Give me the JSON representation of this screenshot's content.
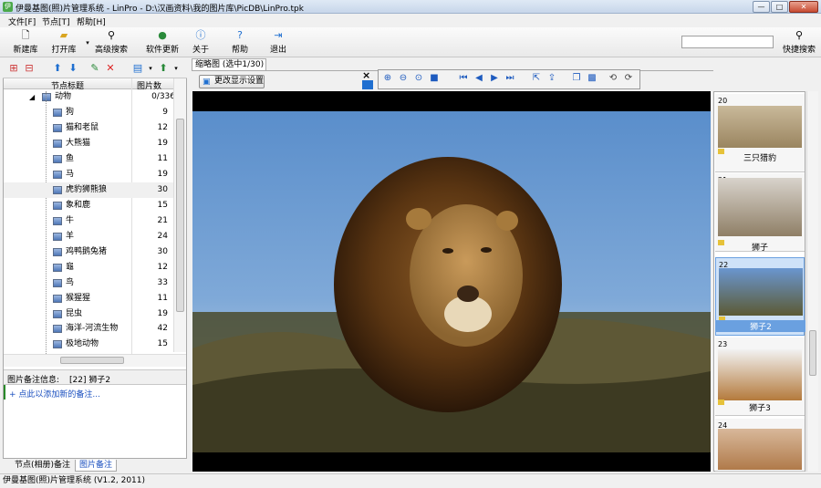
{
  "window": {
    "title": "伊曼基图(照)片管理系统 - LinPro - D:\\汉画资料\\我的图片库\\PicDB\\LinPro.tpk",
    "minimize": "—",
    "maximize": "□",
    "close": "✕"
  },
  "menubar": [
    "文件[F]",
    "节点[T]",
    "帮助[H]"
  ],
  "toolbar": {
    "new_db": "新建库",
    "open_db": "打开库",
    "advanced_search": "高级搜索",
    "update": "软件更新",
    "about": "关于",
    "help": "帮助",
    "exit": "退出",
    "quick_search": "快捷搜索",
    "search_value": ""
  },
  "tree": {
    "col_title": "节点标题",
    "col_count": "图片数",
    "root": {
      "label": "动物",
      "count": "0/336"
    },
    "items": [
      {
        "label": "狗",
        "count": "9"
      },
      {
        "label": "猫和老鼠",
        "count": "12"
      },
      {
        "label": "大熊猫",
        "count": "19"
      },
      {
        "label": "鱼",
        "count": "11"
      },
      {
        "label": "马",
        "count": "19"
      },
      {
        "label": "虎豹狮熊狼",
        "count": "30"
      },
      {
        "label": "象和鹿",
        "count": "15"
      },
      {
        "label": "牛",
        "count": "21"
      },
      {
        "label": "羊",
        "count": "24"
      },
      {
        "label": "鸡鸭鹅兔猪",
        "count": "30"
      },
      {
        "label": "龜",
        "count": "12"
      },
      {
        "label": "鸟",
        "count": "33"
      },
      {
        "label": "猴猩猩",
        "count": "11"
      },
      {
        "label": "昆虫",
        "count": "19"
      },
      {
        "label": "海洋-河流生物",
        "count": "42"
      },
      {
        "label": "极地动物",
        "count": "15"
      }
    ]
  },
  "note": {
    "label": "图片备注信息:",
    "current": "[22] 狮子2",
    "add_link": "+ 点此以添加新的备注..."
  },
  "bottom_tabs": [
    "节点(相册)备注",
    "图片备注"
  ],
  "content": {
    "tab": "缩略图 (选中1/30)",
    "change_display": "更改显示设置",
    "close_x": "×"
  },
  "thumbnails": [
    {
      "num": "20",
      "caption": "三只猎豹"
    },
    {
      "num": "21",
      "caption": "狮子"
    },
    {
      "num": "22",
      "caption": "狮子2"
    },
    {
      "num": "23",
      "caption": "狮子3"
    },
    {
      "num": "24",
      "caption": ""
    }
  ],
  "status": "伊曼基图(照)片管理系统 (V1.2, 2011)",
  "colors": {
    "accent": "#1f6fd0",
    "selection": "#cfe2f8",
    "link": "#1a4fbf"
  }
}
